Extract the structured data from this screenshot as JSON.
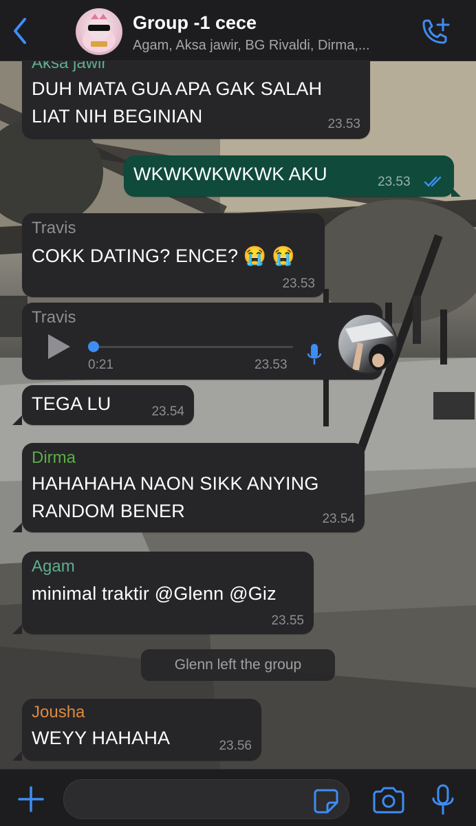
{
  "header": {
    "title": "Group -1 cece",
    "members": "Agam, Aksa jawir, BG Rivaldi, Dirma,..."
  },
  "colors": {
    "accent": "#3e8df5",
    "sender_aksa": "#5fae8e",
    "sender_travis": "#8e8e93",
    "sender_dirma": "#5cae47",
    "sender_agam": "#5fae8e",
    "sender_jousha": "#e08a3c"
  },
  "messages": [
    {
      "sender": "Aksa jawir",
      "line1": "DUH MATA GUA APA GAK SALAH",
      "line2": "LIAT NIH BEGINIAN",
      "time": "23.53"
    },
    {
      "line1": "WKWKWKWKWK AKU",
      "time": "23.53",
      "outgoing": true,
      "status": "read"
    },
    {
      "sender": "Travis",
      "line1": "COKK DATING? ENCE? 😭 😭",
      "time": "23.53"
    },
    {
      "sender": "Travis",
      "type": "voice",
      "duration": "0:21",
      "time": "23.53"
    },
    {
      "line1": "TEGA LU",
      "time": "23.54"
    },
    {
      "sender": "Dirma",
      "line1": "HAHAHAHA NAON SIKK ANYING",
      "line2": "RANDOM BENER",
      "time": "23.54"
    },
    {
      "sender": "Agam",
      "line1": "minimal traktir @Glenn @Giz",
      "time": "23.55"
    },
    {
      "sender": "Jousha",
      "line1": "WEYY HAHAHA",
      "time": "23.56"
    }
  ],
  "system_message": "Glenn left the group",
  "icons": {
    "back": "chevron-left-icon",
    "call": "phone-plus-icon",
    "plus": "plus-icon",
    "sticker": "sticker-icon",
    "camera": "camera-icon",
    "mic": "microphone-icon",
    "play": "play-icon"
  }
}
